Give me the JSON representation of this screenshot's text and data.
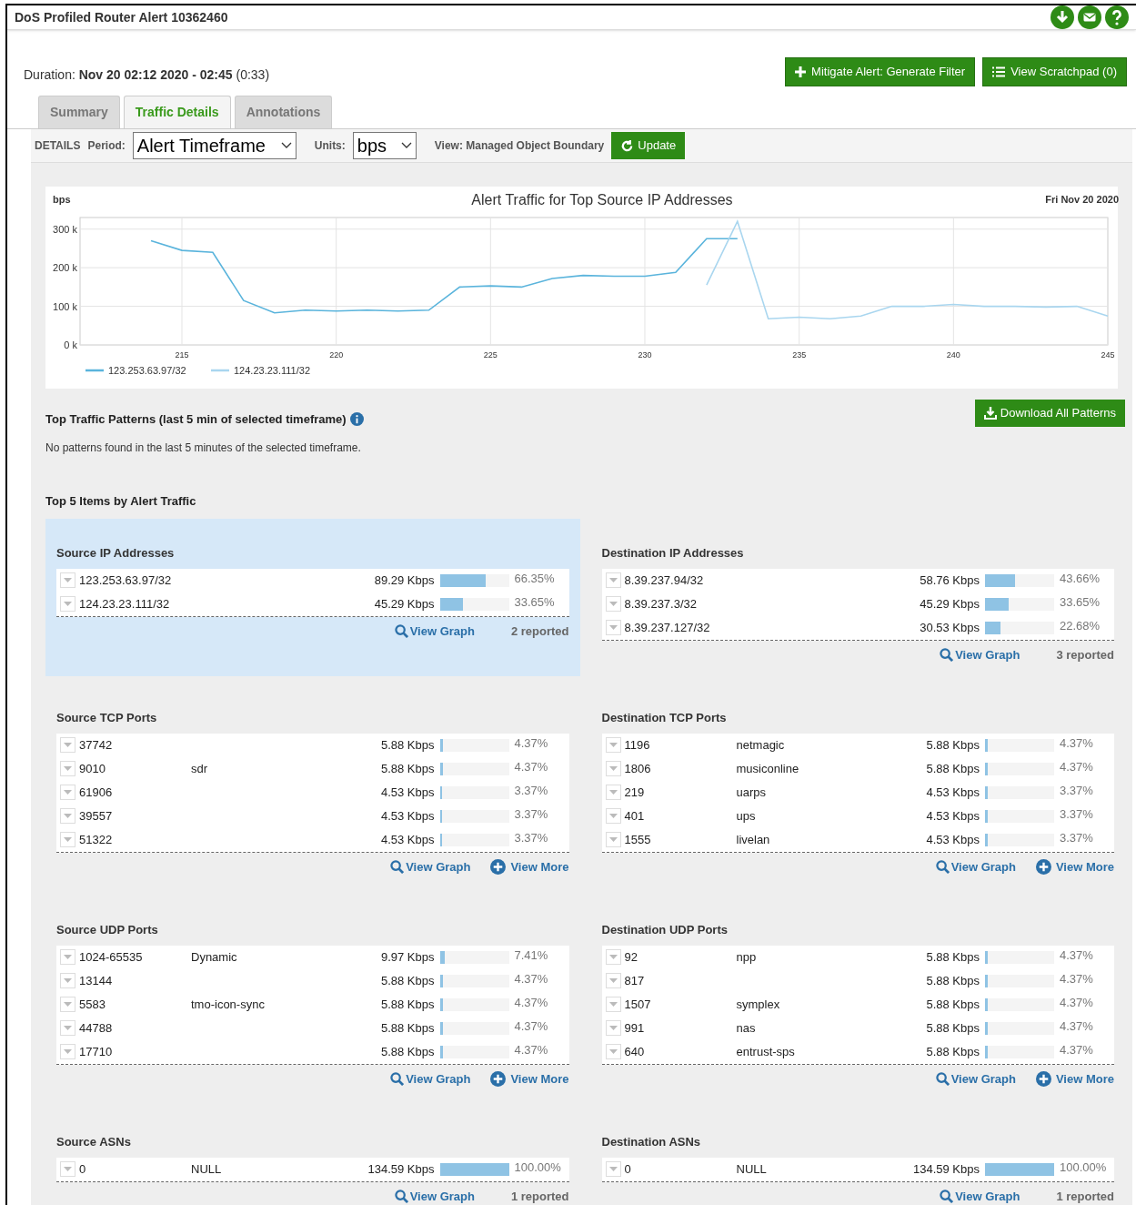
{
  "window": {
    "title": "DoS Profiled Router Alert 10362460"
  },
  "duration": {
    "label": "Duration:",
    "value": "Nov 20 02:12 2020 - 02:45",
    "extra": "(0:33)"
  },
  "actions": [
    "Mitigate Alert: Generate Filter",
    "View Scratchpad (0)"
  ],
  "tabs": [
    {
      "label": "Summary",
      "selected": false
    },
    {
      "label": "Traffic Details",
      "selected": true
    },
    {
      "label": "Annotations",
      "selected": false
    }
  ],
  "toolbar": {
    "details": "DETAILS",
    "period_label": "Period:",
    "period": "Alert Timeframe",
    "units_label": "Units:",
    "units": "bps",
    "view": "View: Managed Object Boundary",
    "update": "Update"
  },
  "chart": {
    "date": "Fri Nov 20 2020",
    "chart_data": {
      "type": "line",
      "title": "Alert Traffic for Top Source IP Addresses",
      "ylabel": "bps",
      "x": [
        214,
        215,
        216,
        217,
        218,
        219,
        220,
        221,
        222,
        223,
        224,
        225,
        226,
        227,
        228,
        229,
        230,
        231,
        232,
        233,
        234,
        235,
        236,
        237,
        238,
        239,
        240,
        241,
        242,
        243,
        244,
        245
      ],
      "series": [
        {
          "name": "123.253.63.97/32",
          "color": "#5ab4dc",
          "values": [
            270,
            245,
            240,
            115,
            83,
            90,
            88,
            90,
            88,
            90,
            150,
            153,
            150,
            172,
            180,
            178,
            178,
            188,
            275,
            275,
            null,
            null,
            null,
            null,
            null,
            null,
            null,
            null,
            null,
            null,
            null,
            null
          ]
        },
        {
          "name": "124.23.23.111/32",
          "color": "#a9d6ef",
          "values": [
            null,
            null,
            null,
            null,
            null,
            null,
            null,
            null,
            null,
            null,
            null,
            null,
            null,
            null,
            null,
            null,
            null,
            null,
            155,
            320,
            68,
            72,
            68,
            75,
            100,
            100,
            105,
            100,
            100,
            98,
            100,
            75
          ]
        }
      ],
      "xlim": [
        211.7,
        245
      ],
      "ylim": [
        0,
        330
      ],
      "grid": true,
      "legend": true,
      "xticks": [
        {
          "value": 215,
          "label": "215"
        },
        {
          "value": 220,
          "label": "220"
        },
        {
          "value": 225,
          "label": "225"
        },
        {
          "value": 230,
          "label": "230"
        },
        {
          "value": 235,
          "label": "235"
        },
        {
          "value": 240,
          "label": "240"
        },
        {
          "value": 245,
          "label": "245"
        }
      ],
      "yticks": [
        {
          "value": 0,
          "label": "0 k"
        },
        {
          "value": 100,
          "label": "100 k"
        },
        {
          "value": 200,
          "label": "200 k"
        },
        {
          "value": 300,
          "label": "300 k"
        }
      ]
    }
  },
  "patterns": {
    "title": "Top Traffic Patterns (last 5 min of selected timeframe)",
    "download": "Download All Patterns",
    "message": "No patterns found in the last 5 minutes of the selected timeframe."
  },
  "top_items_title": "Top 5 Items by Alert Traffic",
  "sections": [
    {
      "title": "Source IP Addresses",
      "highlighted": true,
      "rows": [
        {
          "key": "123.253.63.97/32",
          "rate": "89.29 Kbps",
          "level": 0.6635,
          "percent": "66.35%"
        },
        {
          "key": "124.23.23.111/32",
          "rate": "45.29 Kbps",
          "level": 0.3365,
          "percent": "33.65%"
        }
      ],
      "view_graph": "View Graph",
      "reported": "2 reported"
    },
    {
      "title": "Destination IP Addresses",
      "highlighted": false,
      "rows": [
        {
          "key": "8.39.237.94/32",
          "rate": "58.76 Kbps",
          "level": 0.4366,
          "percent": "43.66%"
        },
        {
          "key": "8.39.237.3/32",
          "rate": "45.29 Kbps",
          "level": 0.3365,
          "percent": "33.65%"
        },
        {
          "key": "8.39.237.127/32",
          "rate": "30.53 Kbps",
          "level": 0.2268,
          "percent": "22.68%"
        }
      ],
      "view_graph": "View Graph",
      "reported": "3 reported"
    },
    {
      "title": "Source TCP Ports",
      "highlighted": false,
      "rows": [
        {
          "key": "37742",
          "rate": "5.88 Kbps",
          "level": 0.0437,
          "percent": "4.37%"
        },
        {
          "key": "9010",
          "name": "sdr",
          "rate": "5.88 Kbps",
          "level": 0.0437,
          "percent": "4.37%"
        },
        {
          "key": "61906",
          "rate": "4.53 Kbps",
          "level": 0.0337,
          "percent": "3.37%"
        },
        {
          "key": "39557",
          "rate": "4.53 Kbps",
          "level": 0.0337,
          "percent": "3.37%"
        },
        {
          "key": "51322",
          "rate": "4.53 Kbps",
          "level": 0.0337,
          "percent": "3.37%"
        }
      ],
      "view_graph": "View Graph",
      "view_more": "View More"
    },
    {
      "title": "Destination TCP Ports",
      "highlighted": false,
      "rows": [
        {
          "key": "1196",
          "name": "netmagic",
          "rate": "5.88 Kbps",
          "level": 0.0437,
          "percent": "4.37%"
        },
        {
          "key": "1806",
          "name": "musiconline",
          "rate": "5.88 Kbps",
          "level": 0.0437,
          "percent": "4.37%"
        },
        {
          "key": "219",
          "name": "uarps",
          "rate": "4.53 Kbps",
          "level": 0.0337,
          "percent": "3.37%"
        },
        {
          "key": "401",
          "name": "ups",
          "rate": "4.53 Kbps",
          "level": 0.0337,
          "percent": "3.37%"
        },
        {
          "key": "1555",
          "name": "livelan",
          "rate": "4.53 Kbps",
          "level": 0.0337,
          "percent": "3.37%"
        }
      ],
      "view_graph": "View Graph",
      "view_more": "View More"
    },
    {
      "title": "Source UDP Ports",
      "highlighted": false,
      "rows": [
        {
          "key": "1024-65535",
          "name": "Dynamic",
          "rate": "9.97 Kbps",
          "level": 0.0741,
          "percent": "7.41%"
        },
        {
          "key": "13144",
          "rate": "5.88 Kbps",
          "level": 0.0437,
          "percent": "4.37%"
        },
        {
          "key": "5583",
          "name": "tmo-icon-sync",
          "rate": "5.88 Kbps",
          "level": 0.0437,
          "percent": "4.37%"
        },
        {
          "key": "44788",
          "rate": "5.88 Kbps",
          "level": 0.0437,
          "percent": "4.37%"
        },
        {
          "key": "17710",
          "rate": "5.88 Kbps",
          "level": 0.0437,
          "percent": "4.37%"
        }
      ],
      "view_graph": "View Graph",
      "view_more": "View More"
    },
    {
      "title": "Destination UDP Ports",
      "highlighted": false,
      "rows": [
        {
          "key": "92",
          "name": "npp",
          "rate": "5.88 Kbps",
          "level": 0.0437,
          "percent": "4.37%"
        },
        {
          "key": "817",
          "rate": "5.88 Kbps",
          "level": 0.0437,
          "percent": "4.37%"
        },
        {
          "key": "1507",
          "name": "symplex",
          "rate": "5.88 Kbps",
          "level": 0.0437,
          "percent": "4.37%"
        },
        {
          "key": "991",
          "name": "nas",
          "rate": "5.88 Kbps",
          "level": 0.0437,
          "percent": "4.37%"
        },
        {
          "key": "640",
          "name": "entrust-sps",
          "rate": "5.88 Kbps",
          "level": 0.0437,
          "percent": "4.37%"
        }
      ],
      "view_graph": "View Graph",
      "view_more": "View More"
    },
    {
      "title": "Source ASNs",
      "highlighted": false,
      "rows": [
        {
          "key": "0",
          "name": "NULL",
          "rate": "134.59 Kbps",
          "level": 1,
          "percent": "100.00%"
        }
      ],
      "view_graph": "View Graph",
      "reported": "1 reported"
    },
    {
      "title": "Destination ASNs",
      "highlighted": false,
      "rows": [
        {
          "key": "0",
          "name": "NULL",
          "rate": "134.59 Kbps",
          "level": 1,
          "percent": "100.00%"
        }
      ],
      "view_graph": "View Graph",
      "reported": "1 reported"
    }
  ]
}
